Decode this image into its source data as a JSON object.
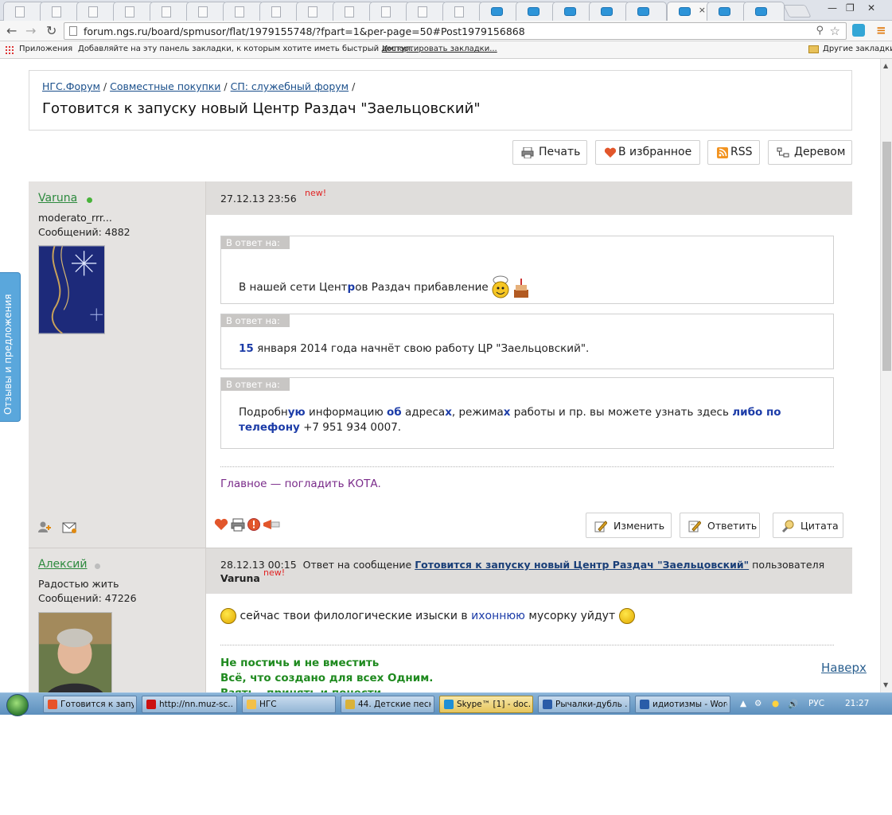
{
  "browser": {
    "url": "forum.ngs.ru/board/spmusor/flat/1979155748/?fpart=1&per-page=50#Post1979156868",
    "bookmarks_apps": "Приложения",
    "bookmarks_hint": "Добавляйте на эту панель закладки, к которым хотите иметь быстрый доступ.",
    "bookmarks_import": "Импортировать закладки...",
    "bookmarks_other": "Другие закладки",
    "tab_close": "×"
  },
  "feedback_tab": "Отзывы и предложения",
  "breadcrumbs": [
    {
      "label": "НГС.Форум"
    },
    {
      "label": "Совместные покупки"
    },
    {
      "label": "СП: служебный форум"
    }
  ],
  "breadcrumb_sep": "/",
  "topic_title": "Готовится к запуску новый Центр Раздач \"Заельцовский\"",
  "actions": {
    "print": "Печать",
    "favorite": "В избранное",
    "rss": "RSS",
    "tree": "Деревом"
  },
  "post1": {
    "username": "Varuna",
    "status": "moderato_rrr...",
    "messages": "Сообщений: 4882",
    "date": "27.12.13 23:56",
    "new": "new!",
    "quote_label": "В ответ на:",
    "quote1_pre": "В нашей сети Цент",
    "quote1_b": "р",
    "quote1_post": "ов Раздач прибавление",
    "quote2_b": "15",
    "quote2_text": " января 2014 года начнёт свою работу ЦР \"Заельцовский\".",
    "quote3_a": "Подробн",
    "quote3_b1": "ую",
    "quote3_c": " информацию ",
    "quote3_b2": "об",
    "quote3_d": " адреса",
    "quote3_b3": "х",
    "quote3_e": ", режима",
    "quote3_b4": "х",
    "quote3_f": " работы и пр. вы можете узнать здесь ",
    "quote3_b5": "либо по телефону",
    "quote3_g": " +7 951 934 0007.",
    "signature": "Главное — погладить КОТА.",
    "edit": "Изменить",
    "reply": "Ответить",
    "quote": "Цитата"
  },
  "post2": {
    "username": "Алексий",
    "status": "Радостью жить",
    "messages": "Сообщений: 47226",
    "date": "28.12.13 00:15",
    "reply_to": "Ответ на сообщение",
    "reply_link": "Готовится к запуску новый Центр Раздач \"Заельцовский\"",
    "of_user": "пользователя",
    "reply_user": "Varuna",
    "new": "new!",
    "text_pre": "сейчас твои филологические изыски в ",
    "text_link": "иxоннюю",
    "text_post": " мусорку уйдут",
    "sig_line1": "Не постичь и не вместить",
    "sig_line2": "Всё, что создано для всех Одним.",
    "sig_line3": "Взять - принять и понести"
  },
  "to_top": "Наверх",
  "taskbar": {
    "items": [
      {
        "label": "Готовится к запу...",
        "icon_color": "#e8532a"
      },
      {
        "label": "http://nn.muz-sc...",
        "icon_color": "#cc1111"
      },
      {
        "label": "НГС",
        "icon_color": "#f2c04a"
      },
      {
        "label": "44. Детские песн...",
        "icon_color": "#d9b23a"
      },
      {
        "label": "Skype™ [1] - doc...",
        "icon_color": "#1f8fd6"
      },
      {
        "label": "Рычалки-дубль ...",
        "icon_color": "#2a5ca8"
      },
      {
        "label": "идиотизмы - Word",
        "icon_color": "#2a5ca8"
      }
    ],
    "lang": "РУС",
    "time": "21:27"
  }
}
